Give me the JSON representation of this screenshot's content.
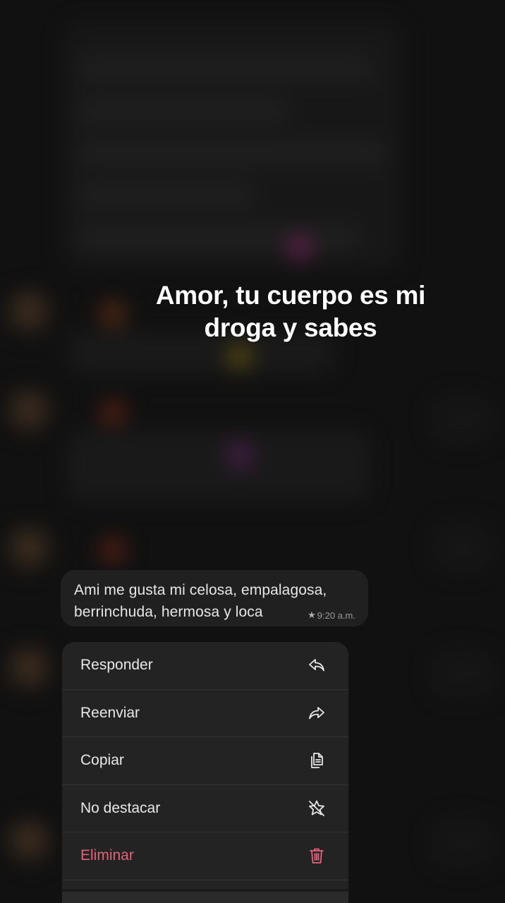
{
  "caption": {
    "line1": "Amor, tu cuerpo es mi",
    "line2": "droga y sabes"
  },
  "message": {
    "line1": "Ami me gusta mi celosa, empalagosa,",
    "line2": "berrinchuda, hermosa y loca",
    "time": "9:20 a.m.",
    "starred": true,
    "star_icon": "star-icon"
  },
  "context_menu": {
    "items": [
      {
        "label": "Responder",
        "icon": "reply-icon"
      },
      {
        "label": "Reenviar",
        "icon": "forward-icon"
      },
      {
        "label": "Copiar",
        "icon": "copy-icon"
      },
      {
        "label": "No destacar",
        "icon": "unstar-icon"
      },
      {
        "label": "Eliminar",
        "icon": "trash-icon",
        "color": "#e5627b"
      }
    ]
  },
  "colors": {
    "background": "#161616",
    "bubble": "#202020",
    "menu": "#232323",
    "danger": "#e5627b"
  }
}
